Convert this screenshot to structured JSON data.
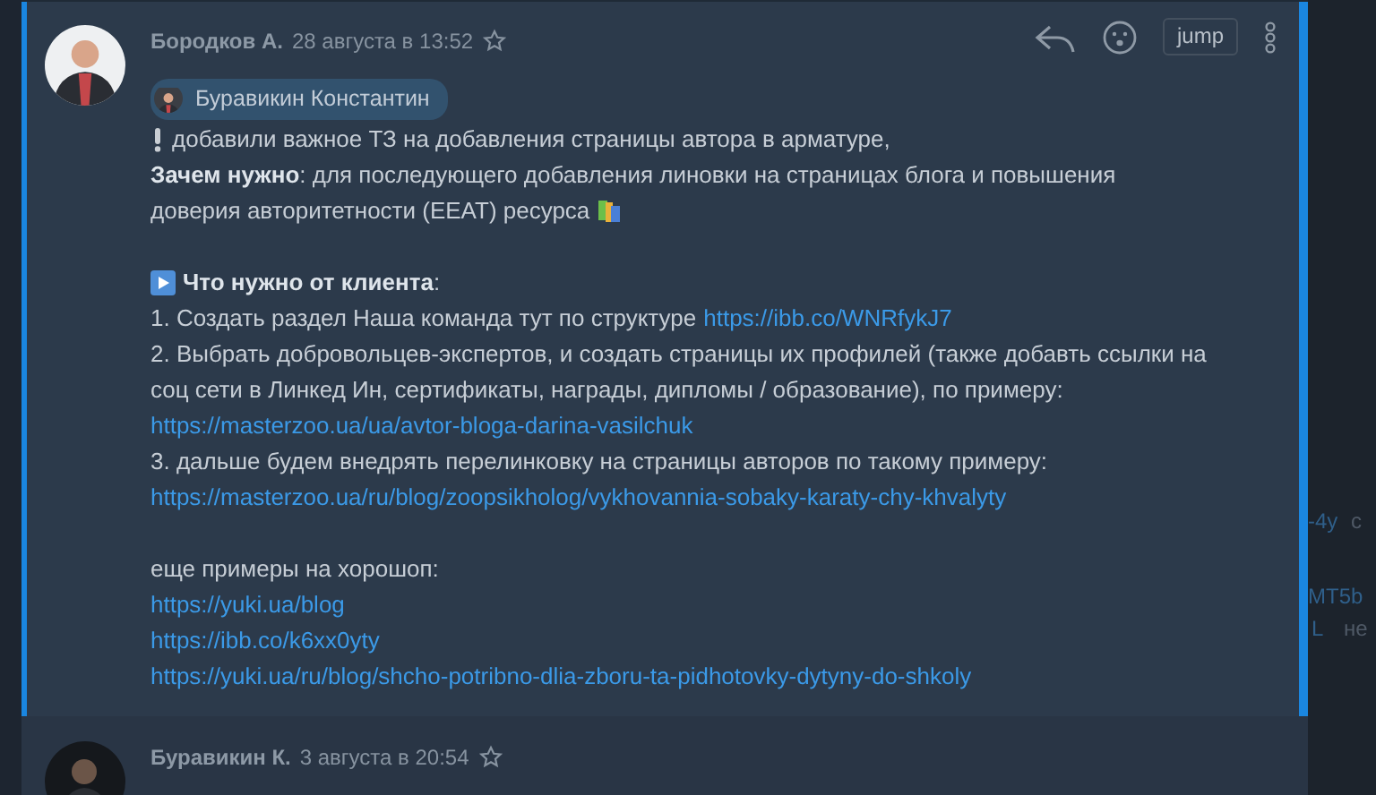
{
  "background": {
    "right_fragments": [
      {
        "text": "-4y",
        "link": true
      },
      {
        "text": "с",
        "link": false
      },
      {
        "text": "MT5b",
        "link": true
      },
      {
        "text": "L",
        "link": true
      },
      {
        "text": "не",
        "link": false
      }
    ]
  },
  "message": {
    "author": "Бородков А.",
    "date": "28 августа в 13:52",
    "starred": false,
    "actions": {
      "jump": "jump"
    },
    "mention": "Буравикин Константин",
    "lines": [
      [
        {
          "kind": "exclamation"
        },
        {
          "kind": "text",
          "text": "добавили важное ТЗ на добавления страницы автора в арматуре,"
        }
      ],
      [
        {
          "kind": "text",
          "text": "**Зачем нужно**: для последующего добавления линовки на страницах блога и повышения"
        }
      ],
      [
        {
          "kind": "text",
          "text": "доверия авторитетности (EEAT) ресурса"
        },
        {
          "kind": "books"
        }
      ],
      [
        {
          "kind": "blank"
        }
      ],
      [
        {
          "kind": "play"
        },
        {
          "kind": "text",
          "text": "**Что нужно от клиента**:"
        }
      ],
      [
        {
          "kind": "text",
          "text": "1. Создать раздел Наша команда тут по структуре"
        },
        {
          "kind": "link",
          "text": "https://ibb.co/WNRfykJ7"
        }
      ],
      [
        {
          "kind": "text",
          "text": "2. Выбрать добровольцев-экспертов, и создать страницы их профилей (также добавть ссылки на"
        }
      ],
      [
        {
          "kind": "text",
          "text": "соц сети в Линкед Ин, сертификаты, награды, дипломы / образование), по примеру:"
        }
      ],
      [
        {
          "kind": "link",
          "text": "https://masterzoo.ua/ua/avtor-bloga-darina-vasilchuk"
        }
      ],
      [
        {
          "kind": "text",
          "text": "3. дальше будем внедрять перелинковку на страницы авторов по такому примеру:"
        }
      ],
      [
        {
          "kind": "link",
          "text": "https://masterzoo.ua/ru/blog/zoopsikholog/vykhovannia-sobaky-karaty-chy-khvalyty"
        }
      ],
      [
        {
          "kind": "blank"
        }
      ],
      [
        {
          "kind": "text",
          "text": "еще примеры на хорошоп:"
        }
      ],
      [
        {
          "kind": "link",
          "text": "https://yuki.ua/blog"
        }
      ],
      [
        {
          "kind": "link",
          "text": "https://ibb.co/k6xx0yty"
        }
      ],
      [
        {
          "kind": "link",
          "text": "https://yuki.ua/ru/blog/shcho-potribno-dlia-zboru-ta-pidhotovky-dytyny-do-shkoly"
        }
      ]
    ]
  },
  "next_message": {
    "author": "Буравикин К.",
    "date": "3 августа в 20:54",
    "starred": false
  }
}
